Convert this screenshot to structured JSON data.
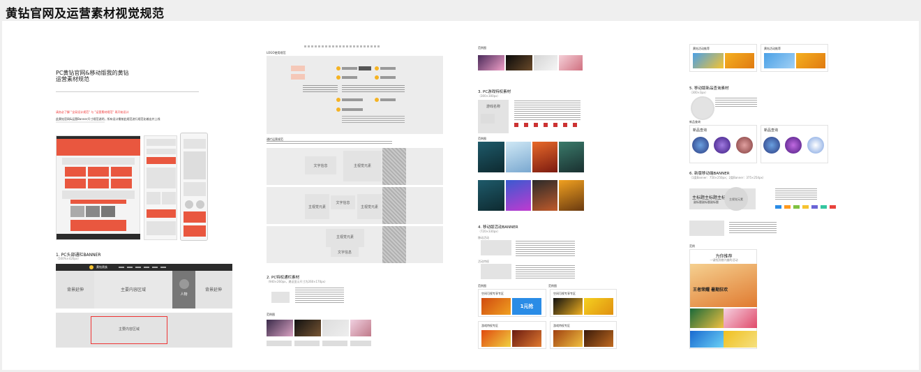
{
  "page": {
    "title": "黄钻官网及运营素材视觉规范"
  },
  "col1": {
    "doc_title": "PC黄钻官网&移动版我的黄钻\n运营素材规范",
    "red_note": "请务必了解 \"全局设计规范\" 与 \"运营素材规范\" 再开始设计",
    "intro": "此黄钻官网&运营Banner尺寸规范说明，所有设计需按此规范进行规范化输出并上线",
    "sec1_title": "1. PC头部通栏BANNER",
    "sec1_size": "（500%×420px）",
    "nav_logo": "黄钻贵族",
    "bg_ext_left": "背景延伸",
    "main_area": "主要内容区域",
    "person": "人物",
    "bg_ext_right": "背景延伸",
    "main_area2": "主要内容区域"
  },
  "col2": {
    "logo_section": "LOGO使用规范",
    "big_area_title": "通栏运营规范",
    "text_info": "文字信息",
    "main_visual": "主视觉元素",
    "sec2_title": "2. PC特权通栏素材",
    "sec2_size": "（940×260px，建议显示尺寸为260×170px）",
    "demo_label": "范例图"
  },
  "col3": {
    "demo": "范例图",
    "sec3_title": "3. PC游戏特权素材",
    "sec3_size": "（300×300px）",
    "game_name": "游戏名称",
    "demo2": "范例图",
    "sec4_title": "4. 移动版活动BANNER",
    "sec4_size": "（720×330px）",
    "sub_a": "移动活动",
    "sub_b": "活动特权",
    "demo3": "范例图",
    "card1": "空间可视专享专区",
    "card2": "空间可视专享专区",
    "card3": "游戏特权专区",
    "card4": "游戏特权专区",
    "promo_text": "1元抢"
  },
  "col4": {
    "card_a": "黄钻活动推荐",
    "card_b": "黄钻活动推荐",
    "sec5_title": "5. 移动版新品查询素材",
    "sec5_size": "（300×3px）",
    "new_label": "新品查询",
    "new_a": "新品查询",
    "new_b": "新品查询",
    "sec6_title": "6. 新版移动端BANNER",
    "sec6_size": "（1类Banner：750×250px；2类Banner：375×254px）",
    "main_title": "主标题主标题主标题",
    "sub_title": "副标题副标题副标题",
    "main_visual": "主视觉元素",
    "demo": "范例",
    "phone_header": "为你推荐",
    "phone_sub": "一键找到感兴趣的活动",
    "game_a": "王者荣耀 暑期狂欢",
    "chips": [
      "#2a8ce6",
      "#ff9a1f",
      "#7fc241",
      "#f5c330",
      "#6a64d6",
      "#34c6a0",
      "#e8433c"
    ]
  }
}
